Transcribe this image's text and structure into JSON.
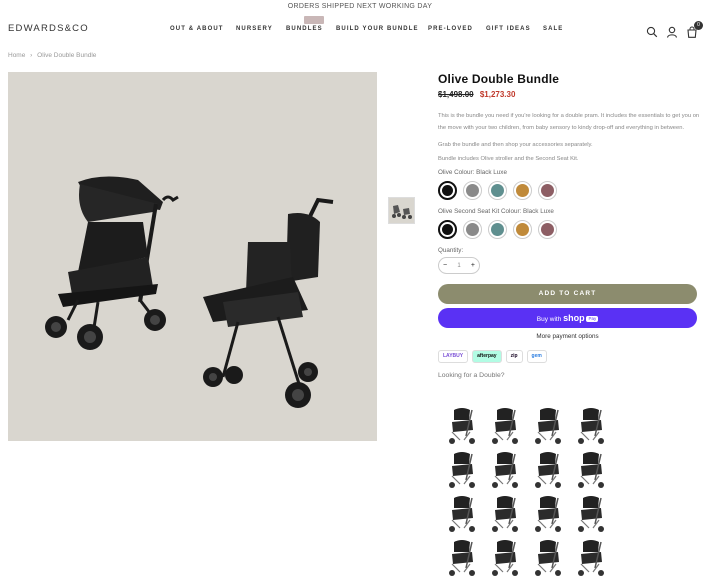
{
  "announcement": "ORDERS SHIPPED NEXT WORKING DAY",
  "header": {
    "logo": "EDWARDS&CO",
    "nav": [
      "OUT & ABOUT",
      "NURSERY",
      "BUNDLES",
      "BUILD YOUR BUNDLE",
      "PRE-LOVED",
      "GIFT IDEAS",
      "SALE"
    ],
    "cart_count": "0"
  },
  "breadcrumb": {
    "home": "Home",
    "separator": "›",
    "current": "Olive Double Bundle"
  },
  "product": {
    "title": "Olive Double Bundle",
    "old_price": "$1,498.00",
    "new_price": "$1,273.30",
    "description": "This is the bundle you need if you're looking for a double pram. It includes the essentials to get you on the move with your two children, from baby sensory to kindy drop-off and everything in between.",
    "para2": "Grab the bundle and then shop your accessories separately.",
    "para3": "Bundle includes Olive stroller and the Second Seat Kit.",
    "colour_label": "Olive Colour: Black Luxe",
    "seat_colour_label": "Olive Second Seat Kit Colour: Black Luxe",
    "swatches": [
      "#111111",
      "#8a8a8a",
      "#5f8f8f",
      "#c08a3a",
      "#8d5e64"
    ],
    "quantity_label": "Quantity:",
    "quantity": "1",
    "add_to_cart": "ADD TO CART",
    "buy_with": "Buy with",
    "shop_word": "shop",
    "shop_tag": "Pay",
    "more_payment": "More payment options",
    "pay_logos": [
      "LAYBUY",
      "afterpay",
      "zip",
      "gem"
    ],
    "looking_for": "Looking for a Double?"
  },
  "colors": {
    "accent_button": "#8c8c6e",
    "shop_pay": "#5a31f4",
    "sale_price": "#c0392b"
  }
}
